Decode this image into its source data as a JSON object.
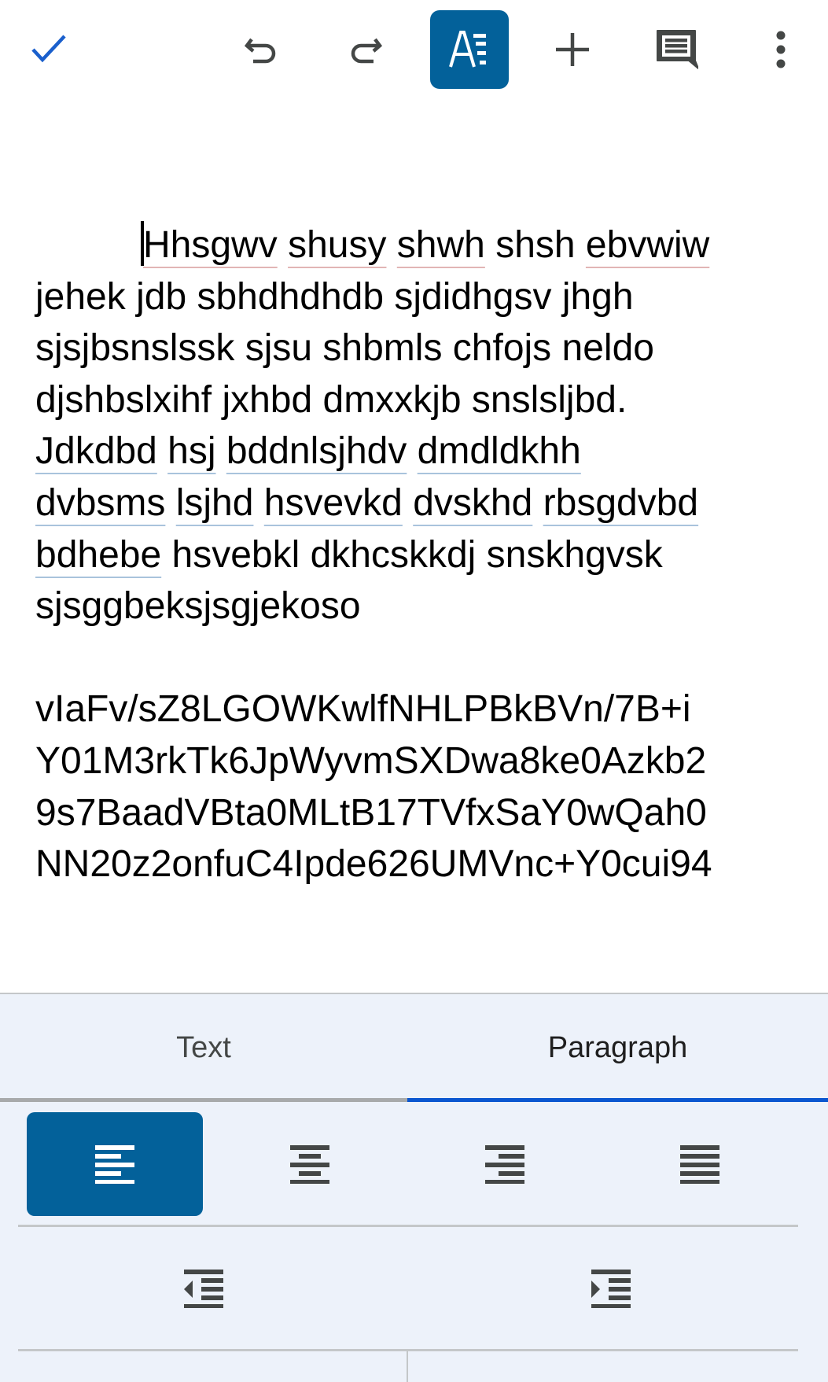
{
  "toolbar": {
    "done_icon": "checkmark-icon",
    "undo_icon": "undo-icon",
    "redo_icon": "redo-icon",
    "format_icon": "text-format-icon",
    "insert_icon": "plus-icon",
    "comment_icon": "comment-icon",
    "more_icon": "more-vertical-icon",
    "format_active": true,
    "colors": {
      "accent": "#1a5fcc",
      "active_bg": "#03619a",
      "icon": "#444746"
    }
  },
  "document": {
    "paragraph1": {
      "lines": [
        [
          {
            "text": "Hhsgwv",
            "mark": "spelling"
          },
          {
            "text": " "
          },
          {
            "text": "shusy",
            "mark": "spelling"
          },
          {
            "text": " "
          },
          {
            "text": "shwh",
            "mark": "spelling"
          },
          {
            "text": " shsh "
          },
          {
            "text": "ebvwiw",
            "mark": "spelling"
          }
        ],
        [
          {
            "text": "jehek jdb sbhdhdhdb sjdidhgsv jhgh"
          }
        ],
        [
          {
            "text": "sjsjbsnslssk sjsu shbmls chfojs neldo"
          }
        ],
        [
          {
            "text": "djshbslxihf jxhbd dmxxkjb snslsljbd."
          }
        ],
        [
          {
            "text": "Jdkdbd",
            "mark": "grammar"
          },
          {
            "text": " "
          },
          {
            "text": "hsj",
            "mark": "grammar"
          },
          {
            "text": " "
          },
          {
            "text": "bddnlsjhdv",
            "mark": "grammar"
          },
          {
            "text": " "
          },
          {
            "text": "dmdldkhh",
            "mark": "grammar"
          }
        ],
        [
          {
            "text": "dvbsms",
            "mark": "grammar"
          },
          {
            "text": " "
          },
          {
            "text": "lsjhd",
            "mark": "grammar"
          },
          {
            "text": " "
          },
          {
            "text": "hsvevkd",
            "mark": "grammar"
          },
          {
            "text": " "
          },
          {
            "text": "dvskhd",
            "mark": "grammar"
          },
          {
            "text": " "
          },
          {
            "text": "rbsgdvbd",
            "mark": "grammar"
          }
        ],
        [
          {
            "text": "bdhebe",
            "mark": "grammar"
          },
          {
            "text": " hsvebkl dkhcskkdj snskhgvsk"
          }
        ],
        [
          {
            "text": "sjsggbeksjsgjekoso"
          }
        ]
      ]
    },
    "paragraph2": {
      "lines": [
        "vIaFv/sZ8LGOWKwlfNHLPBkBVn/7B+i",
        "Y01M3rkTk6JpWyvmSXDwa8ke0Azkb2",
        "9s7BaadVBta0MLtB17TVfxSaY0wQah0",
        "NN20z2onfuC4Ipde626UMVnc+Y0cui94"
      ]
    },
    "spelling_underline_color": "#e2b5b5",
    "grammar_underline_color": "#a9c3dc"
  },
  "format_panel": {
    "tabs": [
      {
        "label": "Text",
        "active": false
      },
      {
        "label": "Paragraph",
        "active": true
      }
    ],
    "alignment": [
      {
        "name": "align-left",
        "icon": "align-left-icon",
        "selected": true
      },
      {
        "name": "align-center",
        "icon": "align-center-icon",
        "selected": false
      },
      {
        "name": "align-right",
        "icon": "align-right-icon",
        "selected": false
      },
      {
        "name": "align-justify",
        "icon": "align-justify-icon",
        "selected": false
      }
    ],
    "indent": [
      {
        "name": "decrease-indent",
        "icon": "decrease-indent-icon"
      },
      {
        "name": "increase-indent",
        "icon": "increase-indent-icon"
      }
    ],
    "colors": {
      "background": "#edf2fa",
      "active_tab_underline": "#0b57d0",
      "selected_bg": "#03619a"
    }
  }
}
